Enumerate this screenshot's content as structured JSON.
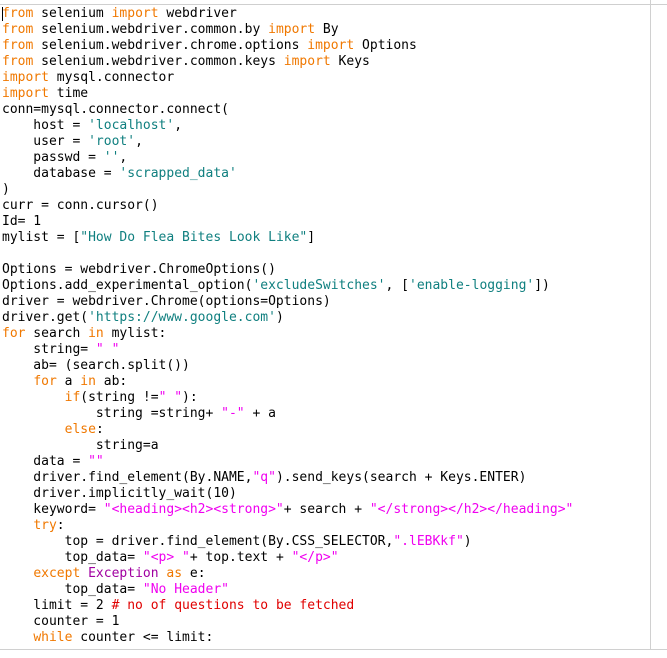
{
  "colors": {
    "keyword": "#f07800",
    "string": "#0f7f7f",
    "string_double": "#f000f0",
    "exception": "#a000a0",
    "comment": "#e00000",
    "text": "#000000"
  },
  "lines": [
    [
      [
        "kw",
        "from"
      ],
      [
        "txt",
        " selenium "
      ],
      [
        "kw",
        "import"
      ],
      [
        "txt",
        " webdriver"
      ]
    ],
    [
      [
        "kw",
        "from"
      ],
      [
        "txt",
        " selenium.webdriver.common.by "
      ],
      [
        "kw",
        "import"
      ],
      [
        "txt",
        " By"
      ]
    ],
    [
      [
        "kw",
        "from"
      ],
      [
        "txt",
        " selenium.webdriver.chrome.options "
      ],
      [
        "kw",
        "import"
      ],
      [
        "txt",
        " Options"
      ]
    ],
    [
      [
        "kw",
        "from"
      ],
      [
        "txt",
        " selenium.webdriver.common.keys "
      ],
      [
        "kw",
        "import"
      ],
      [
        "txt",
        " Keys"
      ]
    ],
    [
      [
        "kw",
        "import"
      ],
      [
        "txt",
        " mysql.connector"
      ]
    ],
    [
      [
        "kw",
        "import"
      ],
      [
        "txt",
        " time"
      ]
    ],
    [
      [
        "txt",
        "conn=mysql.connector.connect("
      ]
    ],
    [
      [
        "txt",
        "    host = "
      ],
      [
        "str",
        "'localhost'"
      ],
      [
        "txt",
        ","
      ]
    ],
    [
      [
        "txt",
        "    user = "
      ],
      [
        "str",
        "'root'"
      ],
      [
        "txt",
        ","
      ]
    ],
    [
      [
        "txt",
        "    passwd = "
      ],
      [
        "str",
        "''"
      ],
      [
        "txt",
        ","
      ]
    ],
    [
      [
        "txt",
        "    database = "
      ],
      [
        "str",
        "'scrapped_data'"
      ]
    ],
    [
      [
        "txt",
        ")"
      ]
    ],
    [
      [
        "txt",
        "curr = conn.cursor()"
      ]
    ],
    [
      [
        "txt",
        "Id= 1"
      ]
    ],
    [
      [
        "txt",
        "mylist = ["
      ],
      [
        "str",
        "\"How Do Flea Bites Look Like\""
      ],
      [
        "txt",
        "]"
      ]
    ],
    [
      [
        "txt",
        ""
      ]
    ],
    [
      [
        "txt",
        "Options = webdriver.ChromeOptions()"
      ]
    ],
    [
      [
        "txt",
        "Options.add_experimental_option("
      ],
      [
        "str",
        "'excludeSwitches'"
      ],
      [
        "txt",
        ", ["
      ],
      [
        "str",
        "'enable-logging'"
      ],
      [
        "txt",
        "])"
      ]
    ],
    [
      [
        "txt",
        "driver = webdriver.Chrome(options=Options)"
      ]
    ],
    [
      [
        "txt",
        "driver.get("
      ],
      [
        "str",
        "'https://www.google.com'"
      ],
      [
        "txt",
        ")"
      ]
    ],
    [
      [
        "kw",
        "for"
      ],
      [
        "txt",
        " search "
      ],
      [
        "kw",
        "in"
      ],
      [
        "txt",
        " mylist:"
      ]
    ],
    [
      [
        "txt",
        "    string= "
      ],
      [
        "dstr",
        "\" \""
      ]
    ],
    [
      [
        "txt",
        "    ab= (search.split())"
      ]
    ],
    [
      [
        "txt",
        "    "
      ],
      [
        "kw",
        "for"
      ],
      [
        "txt",
        " a "
      ],
      [
        "kw",
        "in"
      ],
      [
        "txt",
        " ab:"
      ]
    ],
    [
      [
        "txt",
        "        "
      ],
      [
        "kw",
        "if"
      ],
      [
        "txt",
        "(string !="
      ],
      [
        "dstr",
        "\" \""
      ],
      [
        "txt",
        "):"
      ]
    ],
    [
      [
        "txt",
        "            string =string+ "
      ],
      [
        "dstr",
        "\"-\""
      ],
      [
        "txt",
        " + a"
      ]
    ],
    [
      [
        "txt",
        "        "
      ],
      [
        "kw",
        "else"
      ],
      [
        "txt",
        ":"
      ]
    ],
    [
      [
        "txt",
        "            string=a"
      ]
    ],
    [
      [
        "txt",
        "    data = "
      ],
      [
        "dstr",
        "\"\""
      ]
    ],
    [
      [
        "txt",
        "    driver.find_element(By.NAME,"
      ],
      [
        "dstr",
        "\"q\""
      ],
      [
        "txt",
        ").send_keys(search + Keys.ENTER)"
      ]
    ],
    [
      [
        "txt",
        "    driver.implicitly_wait(10)"
      ]
    ],
    [
      [
        "txt",
        "    keyword= "
      ],
      [
        "dstr",
        "\"<heading><h2><strong>\""
      ],
      [
        "txt",
        "+ search + "
      ],
      [
        "dstr",
        "\"</strong></h2></heading>\""
      ]
    ],
    [
      [
        "txt",
        "    "
      ],
      [
        "kw",
        "try"
      ],
      [
        "txt",
        ":"
      ]
    ],
    [
      [
        "txt",
        "        top = driver.find_element(By.CSS_SELECTOR,"
      ],
      [
        "dstr",
        "\".lEBKkf\""
      ],
      [
        "txt",
        ")"
      ]
    ],
    [
      [
        "txt",
        "        top_data= "
      ],
      [
        "dstr",
        "\"<p> \""
      ],
      [
        "txt",
        "+ top.text + "
      ],
      [
        "dstr",
        "\"</p>\""
      ]
    ],
    [
      [
        "txt",
        "    "
      ],
      [
        "kw",
        "except"
      ],
      [
        "txt",
        " "
      ],
      [
        "exc",
        "Exception"
      ],
      [
        "txt",
        " "
      ],
      [
        "kw",
        "as"
      ],
      [
        "txt",
        " e:"
      ]
    ],
    [
      [
        "txt",
        "        top_data= "
      ],
      [
        "dstr",
        "\"No Header\""
      ]
    ],
    [
      [
        "txt",
        "    limit = 2 "
      ],
      [
        "com",
        "# no of questions to be fetched"
      ]
    ],
    [
      [
        "txt",
        "    counter = 1"
      ]
    ],
    [
      [
        "txt",
        "    "
      ],
      [
        "kw",
        "while"
      ],
      [
        "txt",
        " counter <= limit:"
      ]
    ]
  ]
}
